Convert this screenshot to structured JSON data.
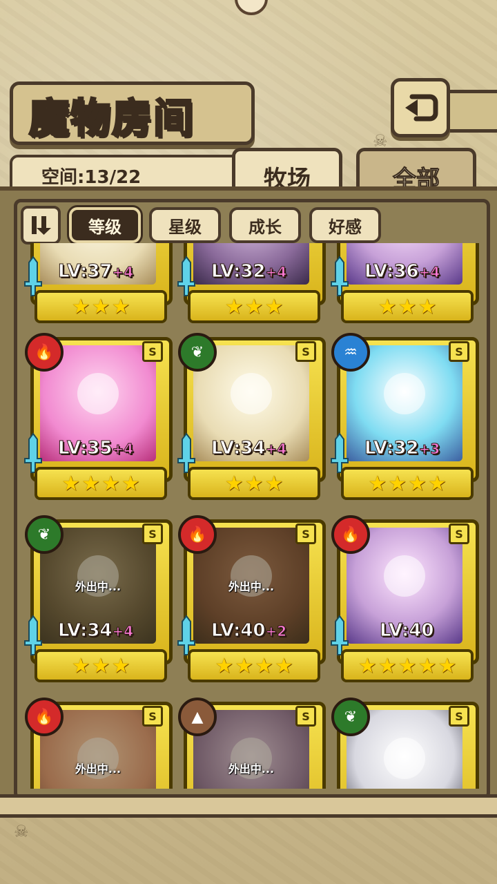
{
  "screen": {
    "title": "魔物房间"
  },
  "space": {
    "label": "空间:13/22"
  },
  "tabs": [
    {
      "label": "牧场",
      "active": true
    },
    {
      "label": "全部",
      "active": false
    }
  ],
  "sort_buttons": [
    {
      "label": "等级",
      "active": true
    },
    {
      "label": "星级",
      "active": false
    },
    {
      "label": "成长",
      "active": false
    },
    {
      "label": "好感",
      "active": false
    }
  ],
  "away_text": "外出中...",
  "monsters_top_row": [
    {
      "level": "LV:37",
      "plus": "+4",
      "stars": 3
    },
    {
      "level": "LV:32",
      "plus": "+4",
      "stars": 3
    },
    {
      "level": "LV:36",
      "plus": "+4",
      "stars": 3
    }
  ],
  "monsters": [
    {
      "element": "fire",
      "icon": "flame-icon",
      "rank": "S",
      "level": "LV:35",
      "plus": "+4",
      "stars": 4,
      "away": false
    },
    {
      "element": "leaf",
      "icon": "leaf-icon",
      "rank": "S",
      "level": "LV:34",
      "plus": "+4",
      "stars": 3,
      "away": false
    },
    {
      "element": "water",
      "icon": "wave-icon",
      "rank": "S",
      "level": "LV:32",
      "plus": "+3",
      "stars": 4,
      "away": false
    },
    {
      "element": "leaf",
      "icon": "leaf-icon",
      "rank": "S",
      "level": "LV:34",
      "plus": "+4",
      "stars": 3,
      "away": true
    },
    {
      "element": "fire",
      "icon": "flame-icon",
      "rank": "S",
      "level": "LV:40",
      "plus": "+2",
      "stars": 4,
      "away": true
    },
    {
      "element": "fire",
      "icon": "flame-icon",
      "rank": "S",
      "level": "LV:40",
      "plus": "",
      "stars": 5,
      "away": false
    },
    {
      "element": "fire",
      "icon": "flame-icon",
      "rank": "S",
      "away": true
    },
    {
      "element": "rock",
      "icon": "mountain-icon",
      "rank": "S",
      "away": true
    },
    {
      "element": "leaf",
      "icon": "leaf-icon",
      "rank": "S",
      "away": false
    }
  ]
}
